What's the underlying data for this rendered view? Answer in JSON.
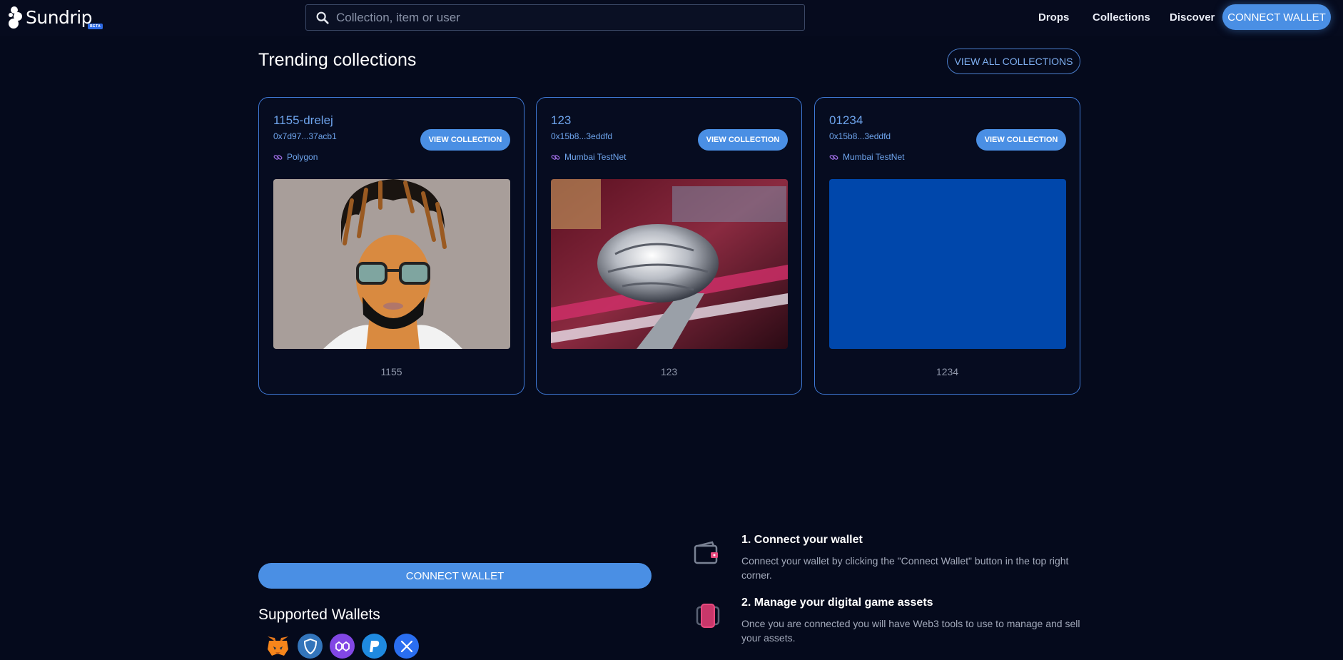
{
  "brand": {
    "name": "Sundrip",
    "badge": "BETA"
  },
  "search": {
    "placeholder": "Collection, item or user",
    "value": ""
  },
  "nav": {
    "drops": "Drops",
    "collections": "Collections",
    "discover": "Discover",
    "connect_wallet": "CONNECT WALLET"
  },
  "trending": {
    "title": "Trending collections",
    "view_all": "VIEW ALL COLLECTIONS",
    "cards": [
      {
        "name": "1155-drelej",
        "address": "0x7d97...37acb1",
        "chain": "Polygon",
        "button": "VIEW COLLECTION",
        "caption": "1155",
        "image": "cartoon-avatar-dreadlocks-glasses"
      },
      {
        "name": "123",
        "address": "0x15b8...3eddfd",
        "chain": "Mumbai TestNet",
        "button": "VIEW COLLECTION",
        "caption": "123",
        "image": "chrome-car-mirror"
      },
      {
        "name": "01234",
        "address": "0x15b8...3eddfd",
        "chain": "Mumbai TestNet",
        "button": "VIEW COLLECTION",
        "caption": "1234",
        "image": "solid-blue",
        "image_color": "#0047ab"
      }
    ]
  },
  "bottom": {
    "connect_wallet": "CONNECT WALLET",
    "supported_title": "Supported Wallets",
    "wallets": [
      "metamask-icon",
      "trust-wallet-icon",
      "polygon-icon",
      "paypal-icon",
      "xdefi-icon"
    ],
    "steps": [
      {
        "title": "1. Connect your wallet",
        "text": "Connect your wallet by clicking the \"Connect Wallet\" button in the top right corner.",
        "icon": "wallet-icon"
      },
      {
        "title": "2. Manage your digital game assets",
        "text": "Once you are connected you will have Web3 tools to use to manage and sell your assets.",
        "icon": "phone-icon"
      }
    ]
  },
  "colors": {
    "background": "#050a1c",
    "accent": "#4a8fe4",
    "card_border": "#3f79d6",
    "link_blue": "#6ea4ec"
  }
}
